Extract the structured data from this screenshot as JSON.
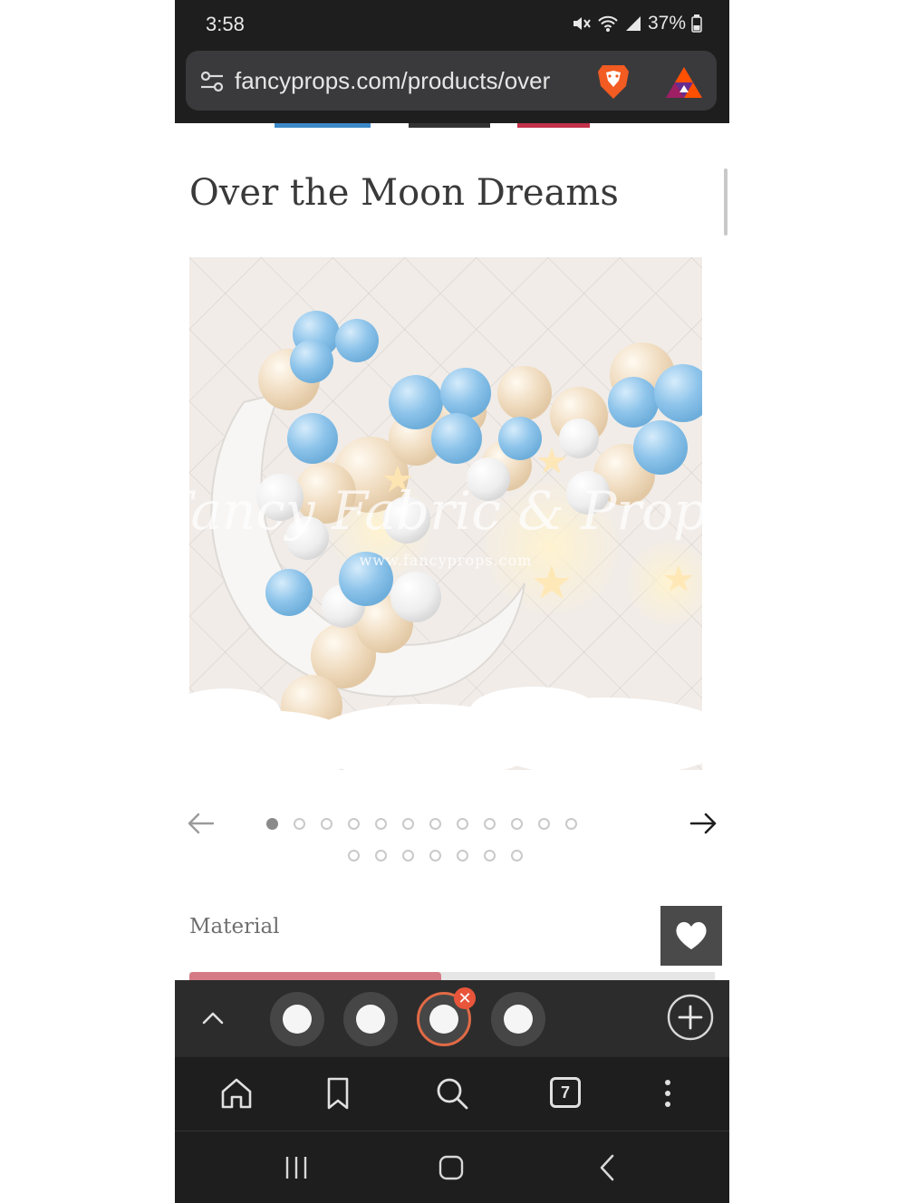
{
  "status_bar": {
    "time": "3:58",
    "battery": "37%",
    "icons": [
      "mute-icon",
      "wifi-icon",
      "signal-icon",
      "battery-icon"
    ]
  },
  "url_bar": {
    "url": "fancyprops.com/products/over",
    "icons": [
      "site-settings-icon",
      "brave-shields-icon",
      "brave-rewards-icon"
    ]
  },
  "page": {
    "title": "Over the Moon Dreams",
    "product_image": {
      "watermark_script": "Fancy Fabric & Props",
      "watermark_url": "www.fancyprops.com"
    },
    "gallery": {
      "total_images": 19,
      "current_index": 1
    },
    "material_label": "Material",
    "material_bar_fill": 0.48
  },
  "tab_strip": {
    "open_tabs_shown": 4,
    "active_tab": 3,
    "close_symbol": "✕"
  },
  "toolbar": {
    "tab_count": "7",
    "icons": [
      "home-icon",
      "bookmark-icon",
      "search-icon",
      "tabs-icon",
      "more-icon"
    ]
  },
  "navigation": {
    "icons": [
      "recents-icon",
      "home-button-icon",
      "back-icon"
    ]
  },
  "colors": {
    "system_bar": "#1e1e1e",
    "url_bar": "#3a3a3c",
    "title_text": "#3a3a3a",
    "material_accent": "#d67a86",
    "active_tab_ring": "#e06a46",
    "balloon_blue": "#8cc3ea",
    "balloon_cream": "#f0dcc0"
  }
}
